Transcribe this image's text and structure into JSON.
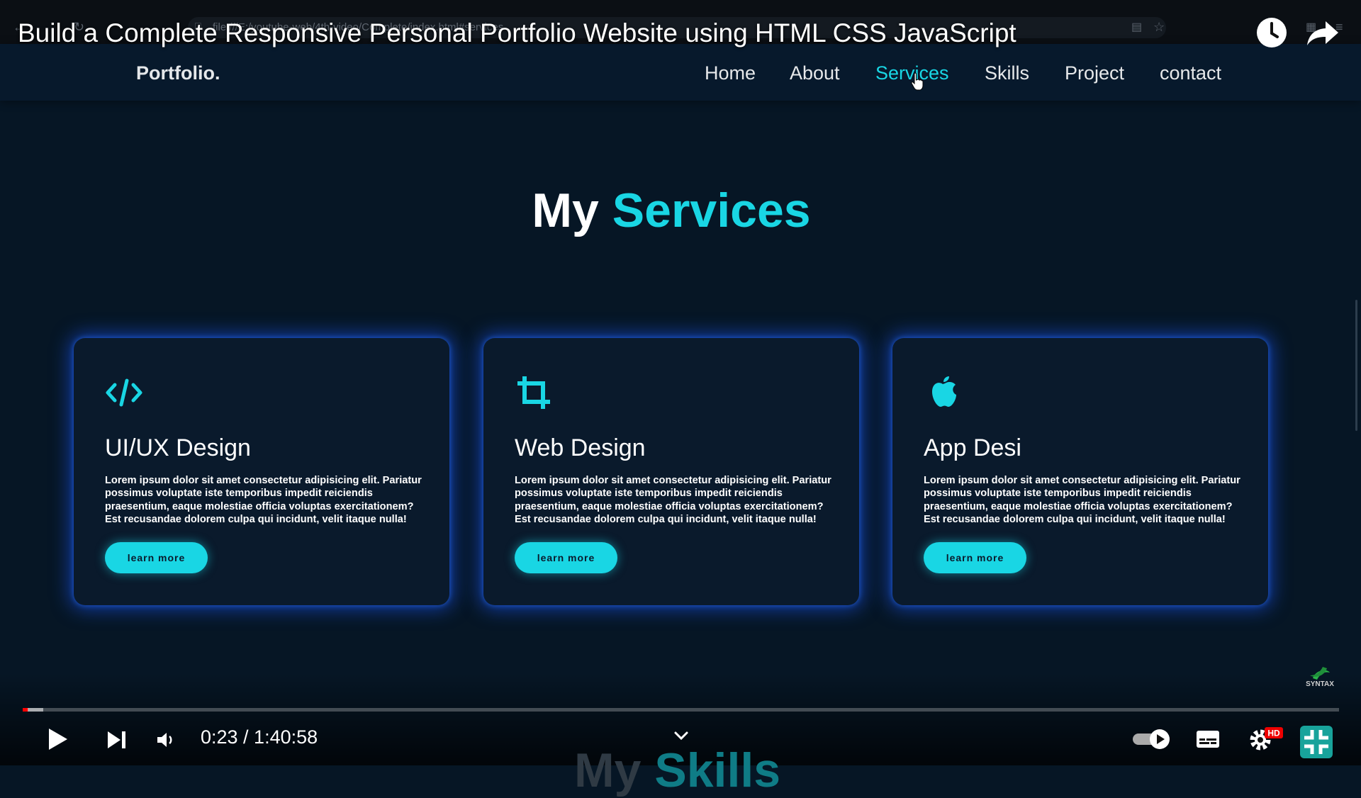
{
  "browser": {
    "url": "file:///E:/youtube-web/4th-video/Complete/index.html#services"
  },
  "video": {
    "title": "Build a Complete Responsive Personal Portfolio Website using HTML CSS JavaScript",
    "time": "0:23 / 1:40:58",
    "progress_fraction": 0.0038,
    "watermark": "SYNTAX"
  },
  "site": {
    "logo": "Portfolio.",
    "nav": [
      {
        "label": "Home",
        "active": false
      },
      {
        "label": "About",
        "active": false
      },
      {
        "label": "Services",
        "active": true
      },
      {
        "label": "Skills",
        "active": false
      },
      {
        "label": "Project",
        "active": false
      },
      {
        "label": "contact",
        "active": false
      }
    ],
    "heading": {
      "part1": "My",
      "part2": "Services"
    },
    "cards": [
      {
        "icon": "code-icon",
        "title": "UI/UX Design",
        "text": "Lorem ipsum dolor sit amet consectetur adipisicing elit. Pariatur possimus voluptate iste temporibus impedit reiciendis praesentium, eaque molestiae officia voluptas exercitationem? Est recusandae dolorem culpa qui incidunt, velit itaque nulla!",
        "button": "learn more"
      },
      {
        "icon": "crop-icon",
        "title": "Web Design",
        "text": "Lorem ipsum dolor sit amet consectetur adipisicing elit. Pariatur possimus voluptate iste temporibus impedit reiciendis praesentium, eaque molestiae officia voluptas exercitationem? Est recusandae dolorem culpa qui incidunt, velit itaque nulla!",
        "button": "learn more"
      },
      {
        "icon": "apple-icon",
        "title": "App Desi",
        "text": "Lorem ipsum dolor sit amet consectetur adipisicing elit. Pariatur possimus voluptate iste temporibus impedit reiciendis praesentium, eaque molestiae officia voluptas exercitationem? Est recusandae dolorem culpa qui incidunt, velit itaque nulla!",
        "button": "learn more"
      }
    ],
    "next_section_peek": {
      "part1": "My",
      "part2": "Skills"
    }
  },
  "colors": {
    "accent": "#19d6e4",
    "background": "#061625",
    "card": "#0a1a2c",
    "glow": "#1e5aff",
    "progress": "#ff0000"
  }
}
